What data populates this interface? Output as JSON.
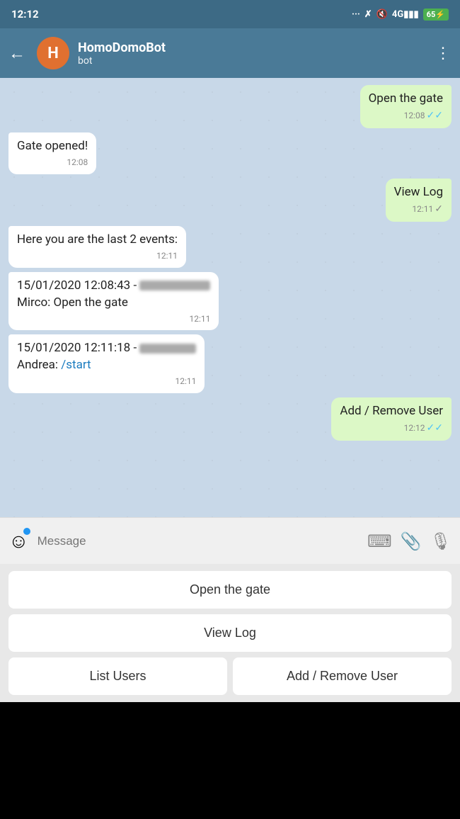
{
  "statusBar": {
    "time": "12:12",
    "battery": "65"
  },
  "header": {
    "avatarLetter": "H",
    "botName": "HomoDomoBot",
    "subtitle": "bot",
    "moreIcon": "⋮"
  },
  "messages": [
    {
      "type": "sent",
      "text": "Open the gate",
      "time": "12:08",
      "checks": "double"
    },
    {
      "type": "received",
      "text": "Gate opened!",
      "time": "12:08"
    },
    {
      "type": "sent",
      "text": "View Log",
      "time": "12:11",
      "checks": "single"
    },
    {
      "type": "received",
      "text": "Here you are the last 2 events:",
      "time": "12:11"
    },
    {
      "type": "received",
      "text": "15/01/2020 12:08:43 - [REDACTED]\nMirco: Open the gate",
      "time": "12:11"
    },
    {
      "type": "received",
      "text": "15/01/2020 12:11:18 - [REDACTED]\nAndrea: /start",
      "time": "12:11",
      "hasLink": true
    },
    {
      "type": "sent",
      "text": "Add / Remove User",
      "time": "12:12",
      "checks": "double"
    }
  ],
  "inputBar": {
    "placeholder": "Message",
    "emojiIcon": "☺",
    "keyboardIcon": "⌨",
    "attachIcon": "⊘",
    "micIcon": "🎤"
  },
  "bottomButtons": {
    "btn1": "Open the gate",
    "btn2": "View Log",
    "btn3": "List Users",
    "btn4": "Add / Remove User"
  }
}
